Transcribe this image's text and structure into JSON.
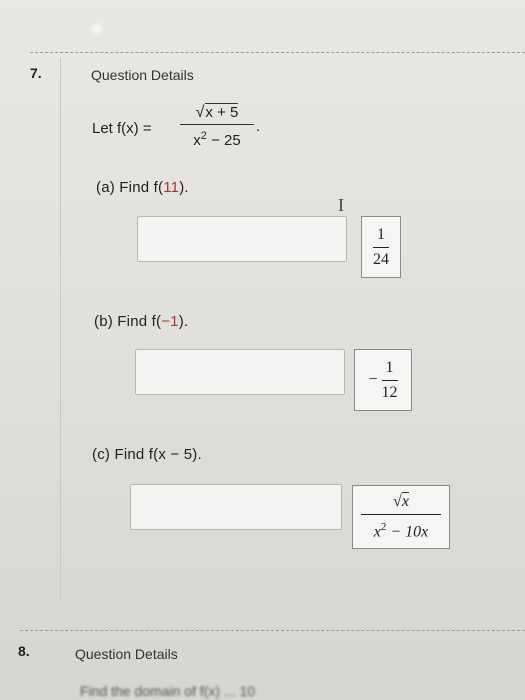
{
  "question7": {
    "number": "7.",
    "details_label": "Question Details",
    "function": {
      "prefix": "Let f(x) =",
      "numerator": "x + 5",
      "denominator": "x",
      "denominator_exp": "2",
      "denominator_rest": " − 25",
      "trailing": "."
    },
    "parts": [
      {
        "label_prefix": "(a)   Find f(",
        "label_arg": "11",
        "label_suffix": ").",
        "answer_value": "",
        "key": {
          "sign": "",
          "numerator": "1",
          "denominator": "24"
        }
      },
      {
        "label_prefix": "(b)   Find f(",
        "label_arg": "−1",
        "label_suffix": ").",
        "answer_value": "",
        "key": {
          "sign": "−",
          "numerator": "1",
          "denominator": "12"
        }
      },
      {
        "label_prefix": "(c)   Find f(x − 5).",
        "label_arg": "",
        "label_suffix": "",
        "answer_value": "",
        "key": {
          "sign": "",
          "numerator": "x",
          "denominator": "x",
          "denominator_exp": "2",
          "denominator_rest": " − 10x"
        }
      }
    ],
    "cursor_glyph": "I"
  },
  "question8": {
    "number": "8.",
    "details_label": "Question Details",
    "cut_off_text": "Find the domain of f(x) ... 10"
  },
  "colors": {
    "accent_red": "#b03030",
    "border": "#8a8a8a"
  }
}
